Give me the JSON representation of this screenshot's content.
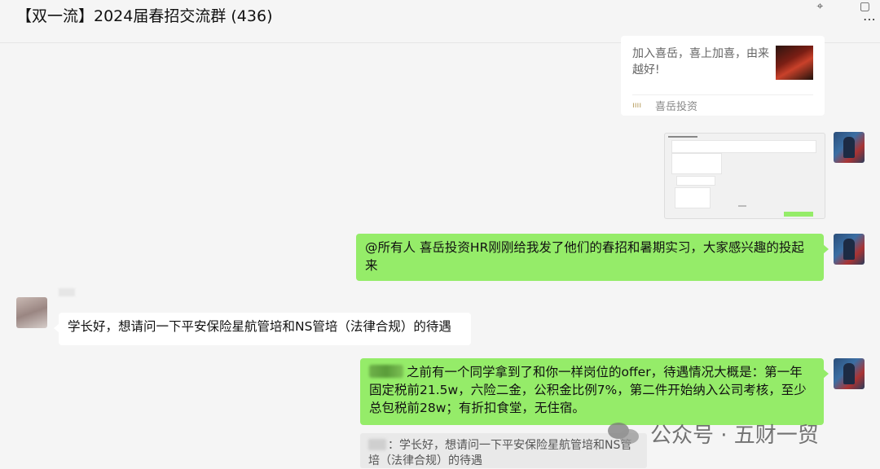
{
  "header": {
    "title": "【双一流】2024届春招交流群 (436)",
    "icons": [
      "pin-icon",
      "window-icon",
      "more-icon"
    ],
    "more_glyph": "⋯"
  },
  "card": {
    "description": "加入喜岳，喜上加喜，由来越好!",
    "source_name": "喜岳投资",
    "source_icon_glyph": "ıııı"
  },
  "messages": {
    "announcement": "@所有人 喜岳投资HR刚刚给我发了他们的春招和暑期实习，大家感兴趣的投起来",
    "question": "学长好，想请问一下平安保险星航管培和NS管培（法律合规）的待遇",
    "reply": "之前有一个同学拿到了和你一样岗位的offer，待遇情况大概是：第一年固定税前21.5w，六险二金，公积金比例7%，第二件开始纳入公司考核，至少总包税前28w；有折扣食堂，无住宿。",
    "quote": "：学长好，想请问一下平安保险星航管培和NS管培（法律合规）的待遇"
  },
  "watermark": {
    "text": "公众号 · 五财一贸"
  },
  "colors": {
    "self_bubble": "#95ec69",
    "other_bubble": "#ffffff",
    "background": "#f5f5f5"
  }
}
